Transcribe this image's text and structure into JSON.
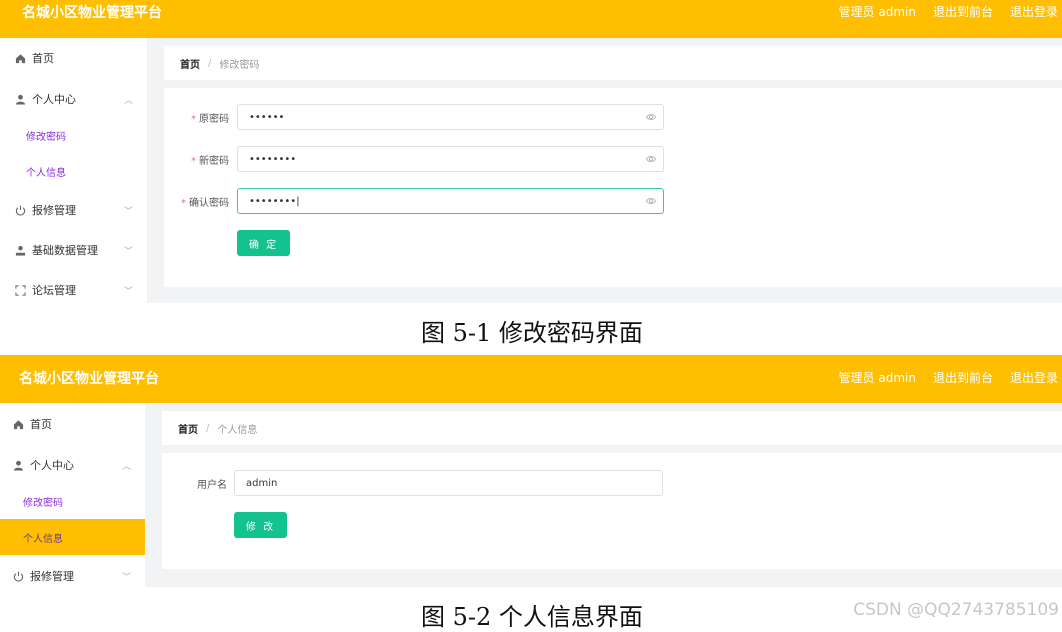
{
  "app_title": "名城小区物业管理平台",
  "top_nav": {
    "admin_label": "管理员 admin",
    "to_front": "退出到前台",
    "logout": "退出登录"
  },
  "menu": {
    "home": "首页",
    "personal_center": "个人中心",
    "change_password": "修改密码",
    "personal_info": "个人信息",
    "repair": "报修管理",
    "basic_data": "基础数据管理",
    "forum": "论坛管理"
  },
  "breadcrumb": {
    "home": "首页",
    "sep": "/",
    "page1": "修改密码",
    "page2": "个人信息"
  },
  "password_form": {
    "old_label": "原密码",
    "old_value": "••••••",
    "new_label": "新密码",
    "new_value": "••••••••",
    "confirm_label": "确认密码",
    "confirm_value": "••••••••",
    "submit": "确 定",
    "required_mark": "*"
  },
  "info_form": {
    "username_label": "用户名",
    "username_value": "admin",
    "submit": "修 改"
  },
  "captions": {
    "fig1": "图 5-1 修改密码界面",
    "fig2": "图 5-2 个人信息界面"
  },
  "watermark": "CSDN @QQ2743785109",
  "colors": {
    "topbar": "#ffbf00",
    "button": "#13c28d",
    "submenu_text": "#8a2be2"
  }
}
